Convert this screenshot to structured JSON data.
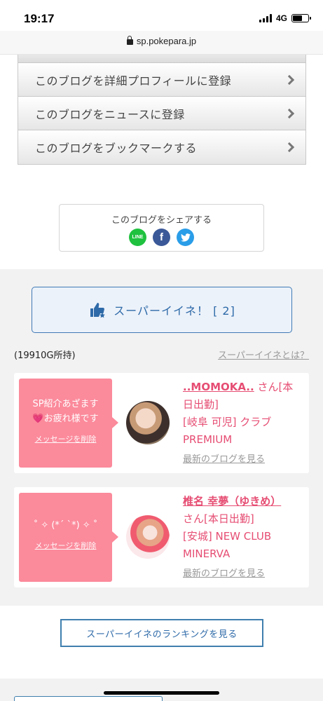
{
  "status": {
    "time": "19:17",
    "network": "4G"
  },
  "browser": {
    "url": "sp.pokepara.jp"
  },
  "menu": {
    "items": [
      {
        "label": "このブログを詳細プロフィールに登録"
      },
      {
        "label": "このブログをニュースに登録"
      },
      {
        "label": "このブログをブックマークする"
      }
    ]
  },
  "share": {
    "title": "このブログをシェアする",
    "line_label": "LINE",
    "facebook_label": "f"
  },
  "super": {
    "button_label": "スーパーイイネ！ [ 2]",
    "owned": "(19910G所持)",
    "whatis_link": "スーパーイイネとは？"
  },
  "cards": [
    {
      "message": "SP紹介あざます\n💗お疲れ様です",
      "delete_label": "メッセージを削除",
      "name": "..MOMOKA..",
      "suffix": "さん[本日出勤]",
      "shop": "[岐阜 可児] クラブPREMIUM",
      "latest_link": "最新のブログを見る"
    },
    {
      "message": "˚ ✧ (*´ `*) ✧ ˚",
      "delete_label": "メッセージを削除",
      "name": "椎名 幸夢（ゆきめ）",
      "suffix": "さん[本日出勤]",
      "shop": "[安城] NEW CLUB MINERVA",
      "latest_link": "最新のブログを見る"
    }
  ],
  "ranking": {
    "label": "スーパーイイネのランキングを見る"
  },
  "colors": {
    "pink": "#fb8a9b",
    "accent_blue": "#2e6aa8",
    "name_pink": "#e64d73"
  }
}
